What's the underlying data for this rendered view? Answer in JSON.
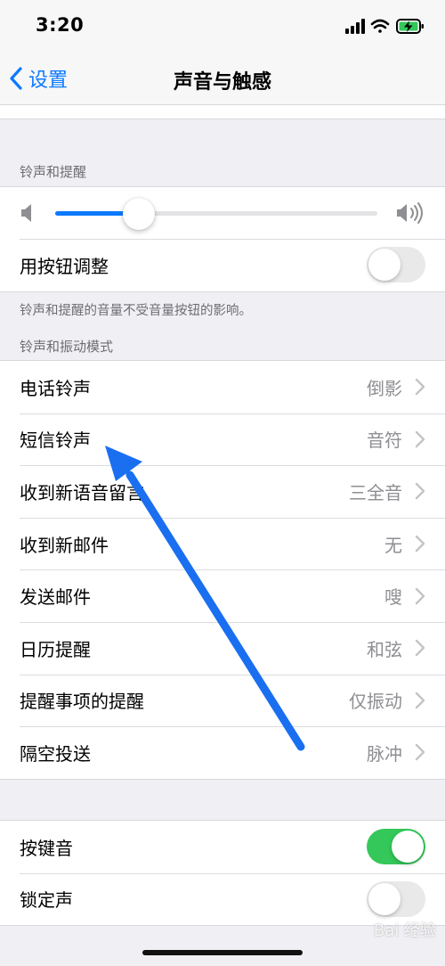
{
  "status_bar": {
    "time": "3:20"
  },
  "nav": {
    "back_label": "设置",
    "title": "声音与触感"
  },
  "ringer_section": {
    "header": "铃声和提醒",
    "volume_level": 0.26,
    "change_with_buttons_label": "用按钮调整",
    "change_with_buttons_on": false,
    "footer": "铃声和提醒的音量不受音量按钮的影响。"
  },
  "patterns_section": {
    "header": "铃声和振动模式",
    "items": [
      {
        "label": "电话铃声",
        "value": "倒影"
      },
      {
        "label": "短信铃声",
        "value": "音符"
      },
      {
        "label": "收到新语音留言",
        "value": "三全音"
      },
      {
        "label": "收到新邮件",
        "value": "无"
      },
      {
        "label": "发送邮件",
        "value": "嗖"
      },
      {
        "label": "日历提醒",
        "value": "和弦"
      },
      {
        "label": "提醒事项的提醒",
        "value": "仅振动"
      },
      {
        "label": "隔空投送",
        "value": "脉冲"
      }
    ]
  },
  "system_section": {
    "items": [
      {
        "label": "按键音",
        "on": true
      },
      {
        "label": "锁定声",
        "on": false
      }
    ]
  },
  "watermark": "Bai 经验",
  "colors": {
    "accent": "#0a7aff",
    "switch_on": "#34c759",
    "annotation_arrow": "#1a6ff0"
  }
}
